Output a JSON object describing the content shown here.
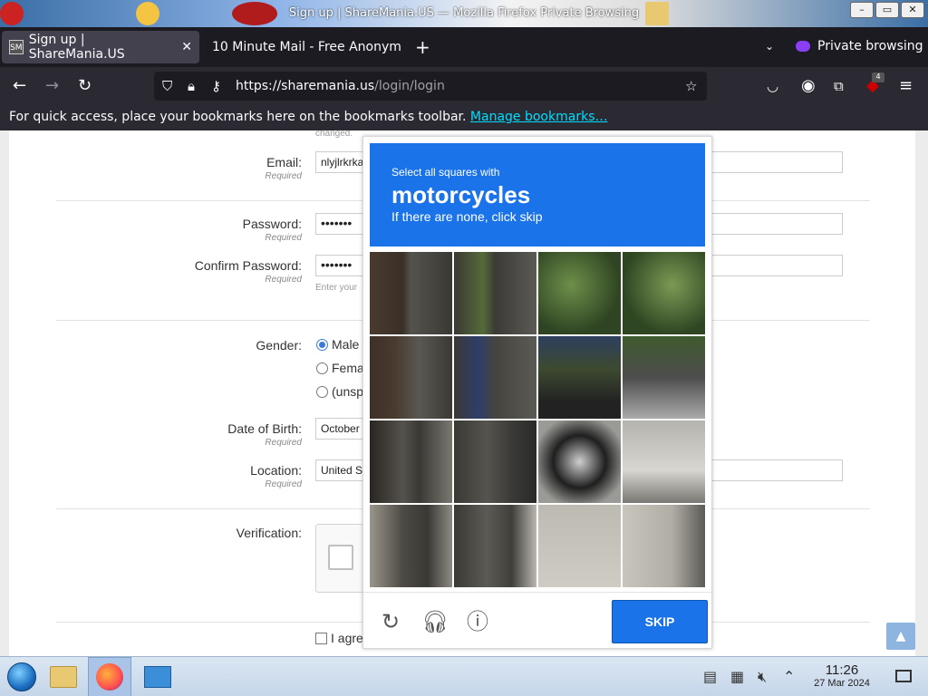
{
  "window": {
    "title": "Sign up | ShareMania.US — Mozilla Firefox Private Browsing",
    "buttons": [
      "–",
      "▭",
      "✕"
    ]
  },
  "tabs": [
    {
      "label": "Sign up | ShareMania.US",
      "favicon": "SM",
      "active": true
    },
    {
      "label": "10 Minute Mail - Free Anonym",
      "active": false
    }
  ],
  "tabbar": {
    "new_tab": "+",
    "list_all": "⌄",
    "private_label": "Private browsing"
  },
  "navbar": {
    "url_host": "https://sharemania.us",
    "url_path": "/login/login",
    "extension_badge": "4"
  },
  "bookmarks_bar": {
    "text": "For quick access, place your bookmarks here on the bookmarks toolbar.",
    "link": "Manage bookmarks…"
  },
  "form": {
    "top_hint": "changed.",
    "email": {
      "label": "Email:",
      "required": "Required",
      "value": "nlyjlrkrka"
    },
    "password": {
      "label": "Password:",
      "required": "Required",
      "value": "•••••••"
    },
    "confirm_password": {
      "label": "Confirm Password:",
      "required": "Required",
      "value": "•••••••",
      "hint": "Enter your"
    },
    "gender": {
      "label": "Gender:",
      "options": [
        "Male",
        "Fema",
        "(unsp"
      ],
      "selected": 0
    },
    "dob": {
      "label": "Date of Birth:",
      "required": "Required",
      "value": "October"
    },
    "location": {
      "label": "Location:",
      "required": "Required",
      "value": "United S"
    },
    "verification": {
      "label": "Verification:"
    },
    "agree": {
      "label": "I agre"
    },
    "scroll_top": "▲"
  },
  "captcha": {
    "prompt_small": "Select all squares with",
    "prompt_object": "motorcycles",
    "prompt_sub": "If there are none, click skip",
    "skip_label": "SKIP",
    "footer_icons": [
      "reload-icon",
      "audio-icon",
      "info-icon"
    ],
    "header_color": "#1a73e8"
  },
  "taskbar": {
    "time": "11:26",
    "date": "27 Mar 2024"
  }
}
